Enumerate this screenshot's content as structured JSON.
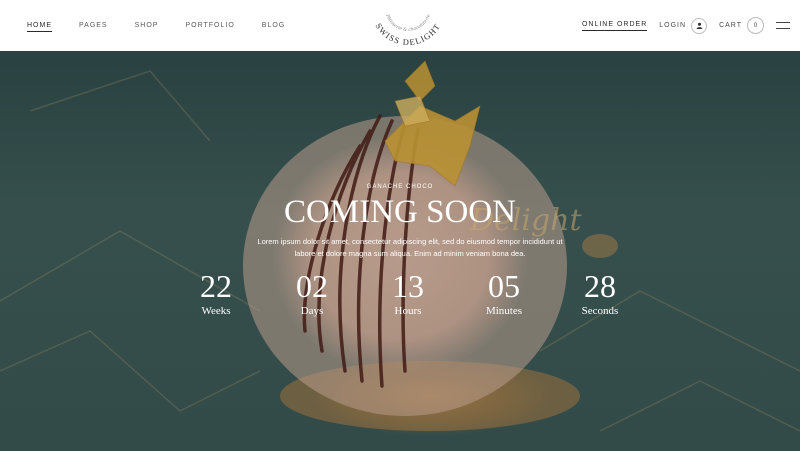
{
  "nav": {
    "items": [
      "HOME",
      "PAGES",
      "SHOP",
      "PORTFOLIO",
      "BLOG"
    ],
    "active_index": 0
  },
  "logo": {
    "name": "SWISS DELIGHT",
    "tagline": "Pâtisserie & chocolaterie"
  },
  "header_right": {
    "online_order": "ONLINE ORDER",
    "login": "LOGIN",
    "cart": "CART",
    "cart_count": "0"
  },
  "hero": {
    "subtitle": "GANACHE CHOCO",
    "title": "COMING SOON",
    "script_word": "Delight",
    "description": "Lorem ipsum dolor sit amet, consectetur adipiscing elit, sed do eiusmod tempor incididunt ut labore et dolore magna sum aliqua. Enim ad minim veniam bona dea."
  },
  "countdown": [
    {
      "value": "22",
      "label": "Weeks"
    },
    {
      "value": "02",
      "label": "Days"
    },
    {
      "value": "13",
      "label": "Hours"
    },
    {
      "value": "05",
      "label": "Minutes"
    },
    {
      "value": "28",
      "label": "Seconds"
    }
  ],
  "colors": {
    "accent_gold": "#c9a56e",
    "text_dark": "#2b2b2b"
  }
}
